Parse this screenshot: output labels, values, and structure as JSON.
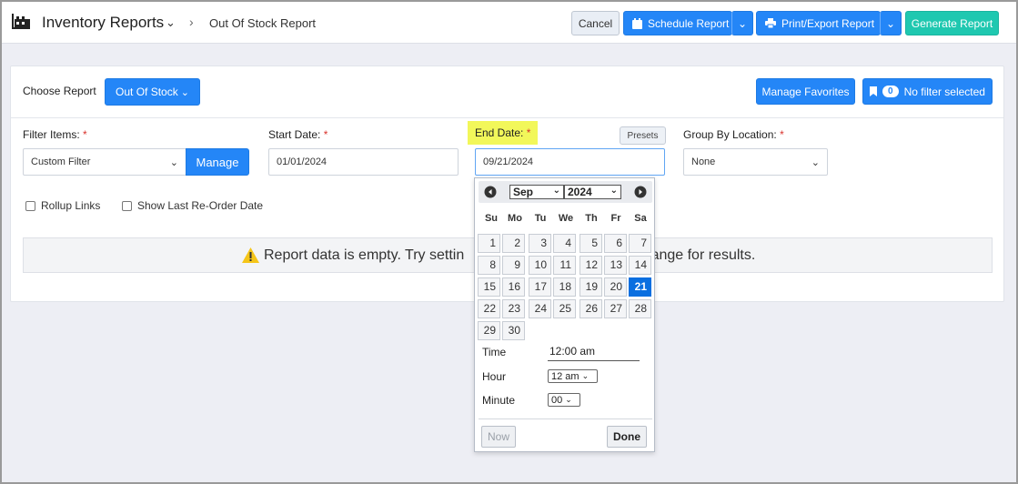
{
  "header": {
    "app_title": "Inventory Reports",
    "breadcrumb": "Out Of Stock Report",
    "buttons": {
      "cancel": "Cancel",
      "schedule": "Schedule Report",
      "print_export": "Print/Export Report",
      "generate": "Generate Report"
    }
  },
  "report": {
    "choose_label": "Choose Report",
    "selected_report": "Out Of Stock",
    "manage_favorites": "Manage Favorites",
    "filter_count": "0",
    "filter_status": "No filter selected"
  },
  "filters": {
    "filter_items_label": "Filter Items:",
    "filter_items_value": "Custom Filter",
    "manage_button": "Manage",
    "start_date_label": "Start Date:",
    "start_date_value": "01/01/2024",
    "end_date_label": "End Date:",
    "end_date_value": "09/21/2024",
    "presets_button": "Presets",
    "group_by_label": "Group By Location:",
    "group_by_value": "None",
    "required_marker": "*"
  },
  "options": {
    "rollup_links": "Rollup Links",
    "show_reorder": "Show Last Re-Order Date"
  },
  "empty_message": {
    "before": "Report data is empty. Try settin",
    "after": "range for results."
  },
  "datepicker": {
    "month": "Sep",
    "year": "2024",
    "weekdays": [
      "Su",
      "Mo",
      "Tu",
      "We",
      "Th",
      "Fr",
      "Sa"
    ],
    "days": [
      "1",
      "2",
      "3",
      "4",
      "5",
      "6",
      "7",
      "8",
      "9",
      "10",
      "11",
      "12",
      "13",
      "14",
      "15",
      "16",
      "17",
      "18",
      "19",
      "20",
      "21",
      "22",
      "23",
      "24",
      "25",
      "26",
      "27",
      "28",
      "29",
      "30"
    ],
    "selected_day": "21",
    "time_label": "Time",
    "time_value": "12:00 am",
    "hour_label": "Hour",
    "hour_value": "12 am",
    "minute_label": "Minute",
    "minute_value": "00",
    "now_button": "Now",
    "done_button": "Done"
  },
  "colors": {
    "primary": "#2486f7",
    "generate": "#1fc8b0",
    "highlight": "#f2f75a",
    "required": "#d9332d",
    "selected_day": "#0a6fe0"
  }
}
